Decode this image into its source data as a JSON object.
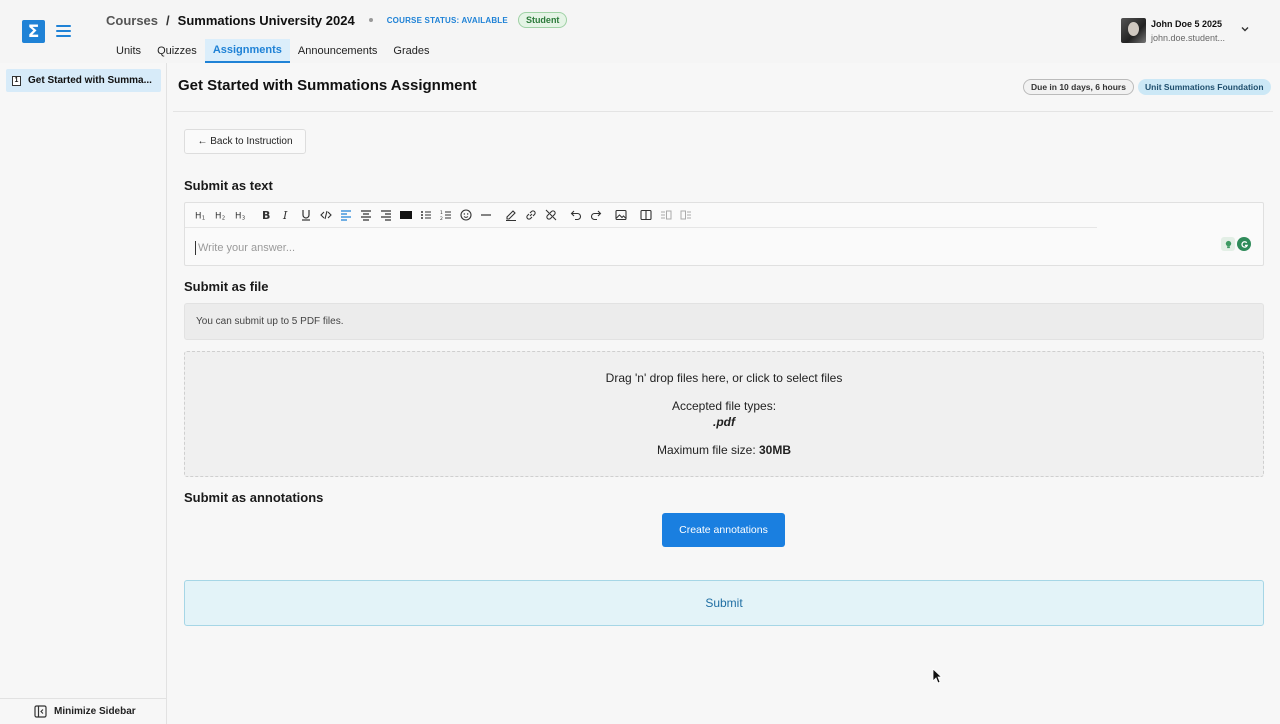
{
  "header": {
    "logo_glyph": "Σ",
    "breadcrumb": {
      "courses": "Courses",
      "separator": "/",
      "course_title": "Summations University 2024"
    },
    "course_status": "COURSE STATUS: AVAILABLE",
    "role_badge": "Student",
    "tabs": [
      {
        "label": "Units",
        "active": false
      },
      {
        "label": "Quizzes",
        "active": false
      },
      {
        "label": "Assignments",
        "active": true
      },
      {
        "label": "Announcements",
        "active": false
      },
      {
        "label": "Grades",
        "active": false
      }
    ],
    "user": {
      "name": "John Doe 5 2025",
      "email": "john.doe.student..."
    }
  },
  "sidebar": {
    "items": [
      {
        "number": "1",
        "label": "Get Started with Summa...",
        "active": true
      }
    ],
    "minimize_label": "Minimize Sidebar"
  },
  "main": {
    "title": "Get Started with Summations Assignment",
    "due_badge": "Due in 10 days, 6 hours",
    "unit_badge": "Unit Summations Foundation",
    "back_button": "← Back to Instruction",
    "text_section": {
      "label": "Submit as text",
      "placeholder": "Write your answer...",
      "toolbar": [
        "heading-1",
        "heading-2",
        "heading-3",
        "bold",
        "italic",
        "underline",
        "code",
        "align-left",
        "align-center",
        "align-right",
        "text-color",
        "bullet-list",
        "ordered-list",
        "emoji",
        "horizontal-rule",
        "highlight",
        "link",
        "unlink",
        "undo",
        "redo",
        "image",
        "split-column",
        "insert-left",
        "insert-right"
      ]
    },
    "file_section": {
      "label": "Submit as file",
      "info": "You can submit up to 5 PDF files.",
      "dropzone": {
        "instruction": "Drag 'n' drop files here, or click to select files",
        "accepted_label": "Accepted file types:",
        "accepted_types": ".pdf",
        "max_size_label": "Maximum file size: ",
        "max_size_value": "30MB"
      }
    },
    "annotation_section": {
      "label": "Submit as annotations",
      "button": "Create annotations"
    },
    "submit_button": "Submit"
  },
  "colors": {
    "accent": "#1f82d6",
    "primary_button": "#1a7fe0",
    "submit_bg": "#e3f3f8"
  }
}
